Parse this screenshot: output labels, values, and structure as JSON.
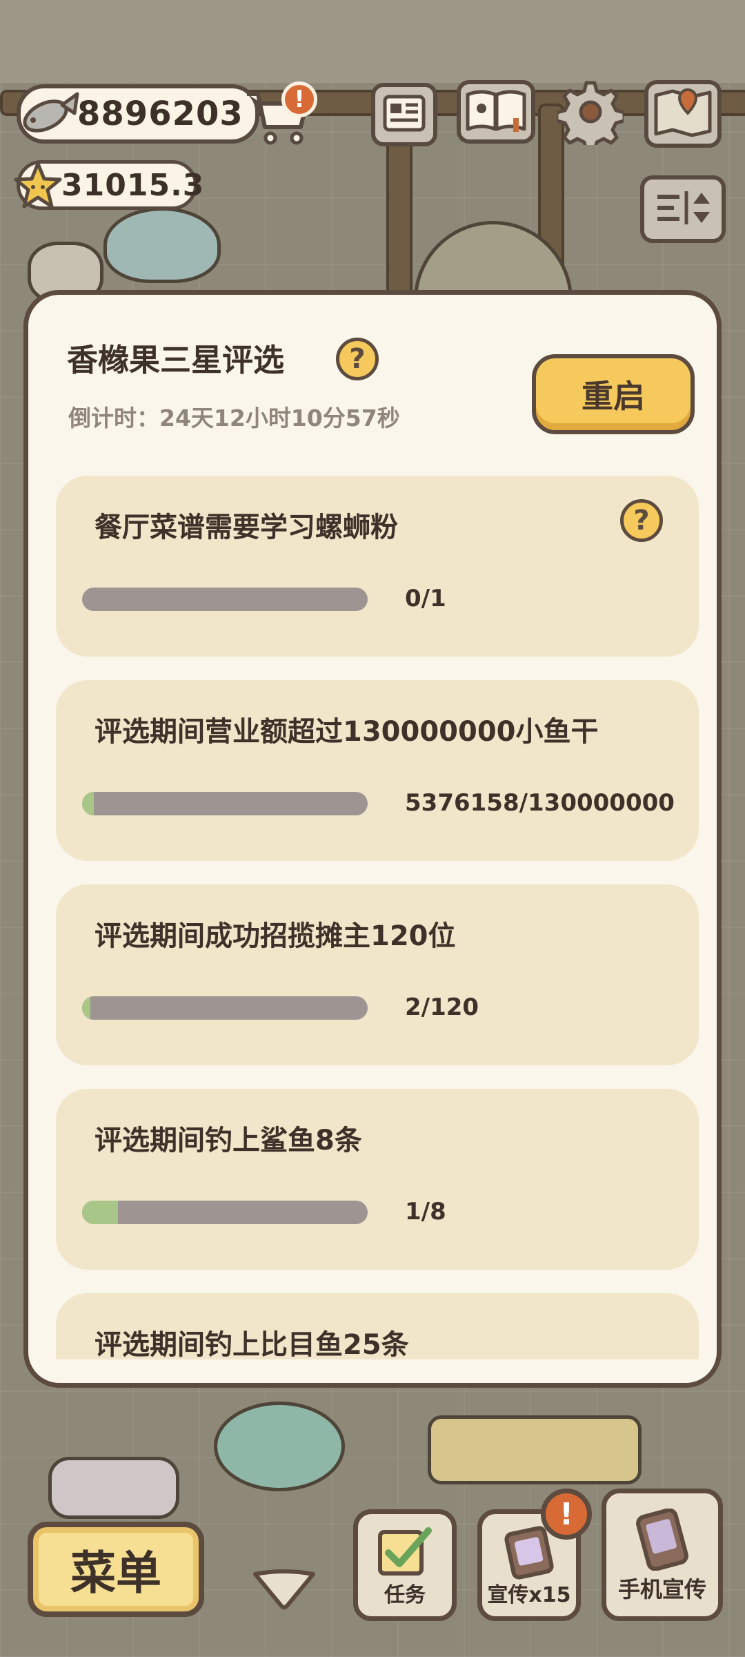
{
  "hud": {
    "fish_currency": "8896203",
    "star_currency": "31015.3",
    "cart_badge": "!"
  },
  "modal": {
    "title": "香橼果三星评选",
    "help_mark": "?",
    "countdown": "倒计时：24天12小时10分57秒",
    "restart_label": "重启",
    "tasks": [
      {
        "text": "餐厅菜谱需要学习螺蛳粉",
        "progress_text": "0/1",
        "progress": 0,
        "has_help": true
      },
      {
        "text": "评选期间营业额超过130000000小鱼干",
        "progress_text": "5376158/130000000",
        "progress": 0.041,
        "has_help": false
      },
      {
        "text": "评选期间成功招揽摊主120位",
        "progress_text": "2/120",
        "progress": 0.017,
        "has_help": false
      },
      {
        "text": "评选期间钓上鲨鱼8条",
        "progress_text": "1/8",
        "progress": 0.125,
        "has_help": false
      },
      {
        "text": "评选期间钓上比目鱼25条",
        "progress_text": "",
        "progress": null,
        "has_help": false
      }
    ]
  },
  "bottom": {
    "menu_label": "菜单",
    "tasks_label": "任务",
    "promote_label": "宣传x15",
    "promote_badge": "!",
    "phone_promote_label": "手机宣传"
  },
  "colors": {
    "accent_yellow": "#f5c95b",
    "outline_brown": "#5c4b3e",
    "card_bg": "#f1e6c9",
    "progress_fill": "#a8c688",
    "progress_track": "#9e9592",
    "badge_orange": "#d86a36"
  }
}
